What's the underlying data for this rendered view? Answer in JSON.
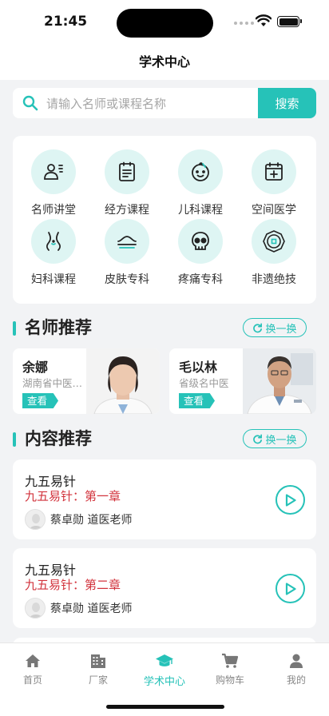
{
  "status": {
    "time": "21:45"
  },
  "header": {
    "title": "学术中心"
  },
  "search": {
    "placeholder": "请输入名师或课程名称",
    "button": "搜索"
  },
  "categories": [
    {
      "label": "名师讲堂",
      "icon": "teacher-icon"
    },
    {
      "label": "经方课程",
      "icon": "document-icon"
    },
    {
      "label": "儿科课程",
      "icon": "baby-icon"
    },
    {
      "label": "空间医学",
      "icon": "medical-calendar-icon"
    },
    {
      "label": "妇科课程",
      "icon": "female-body-icon"
    },
    {
      "label": "皮肤专科",
      "icon": "skin-icon"
    },
    {
      "label": "疼痛专科",
      "icon": "skull-icon"
    },
    {
      "label": "非遗绝技",
      "icon": "coin-icon"
    }
  ],
  "teachers_section": {
    "title": "名师推荐",
    "swap": "换一换",
    "items": [
      {
        "name": "余娜",
        "org": "湖南省中医…",
        "view": "查看"
      },
      {
        "name": "毛以林",
        "org": "省级名中医",
        "view": "查看"
      }
    ]
  },
  "content_section": {
    "title": "内容推荐",
    "swap": "换一换",
    "items": [
      {
        "title": "九五易针",
        "subtitle": "九五易针：第一章",
        "author": "蔡卓勋 道医老师"
      },
      {
        "title": "九五易针",
        "subtitle": "九五易针：第二章",
        "author": "蔡卓勋 道医老师"
      }
    ]
  },
  "tabbar": {
    "active": 2,
    "items": [
      {
        "label": "首页",
        "icon": "home-icon"
      },
      {
        "label": "厂家",
        "icon": "building-icon"
      },
      {
        "label": "学术中心",
        "icon": "graduation-cap-icon"
      },
      {
        "label": "购物车",
        "icon": "cart-icon"
      },
      {
        "label": "我的",
        "icon": "person-icon"
      }
    ]
  },
  "colors": {
    "accent": "#26C2B8",
    "subtitle_red": "#D2333C",
    "background": "#F2F3F5"
  }
}
